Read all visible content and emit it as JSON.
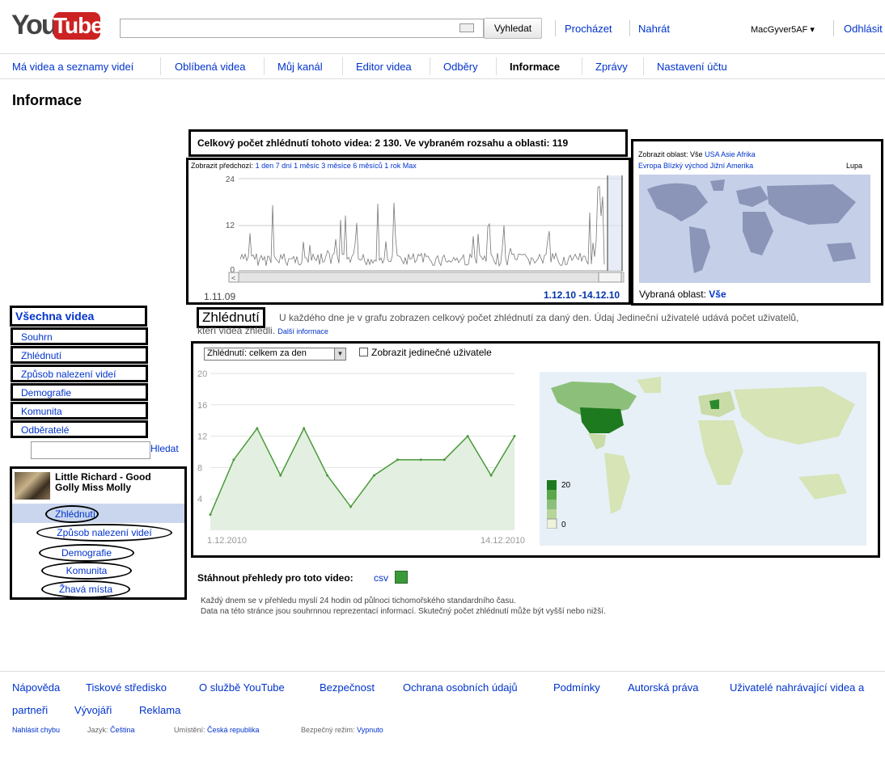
{
  "header": {
    "logo_you": "You",
    "logo_tube": "Tube",
    "search_placeholder": "",
    "search_button": "Vyhledat",
    "browse": "Procházet",
    "upload": "Nahrát",
    "user": "MacGyver5AF ▾",
    "logout": "Odhlásit"
  },
  "tabs": [
    "Má videa a seznamy videí",
    "Oblíbená videa",
    "Můj kanál",
    "Editor videa",
    "Odběry",
    "Informace",
    "Zprávy",
    "Nastavení účtu"
  ],
  "active_tab": "Informace",
  "page_title": "Informace",
  "summary": {
    "text": "Celkový počet zhlédnutí tohoto videa:  2 130.  Ve vybraném rozsahu a oblasti:  119"
  },
  "timeline": {
    "prev_label": "Zobrazit předchozí:",
    "ranges": [
      "1 den",
      "7 dní",
      "1 měsíc",
      "3 měsíce",
      "6 měsíců",
      "1 rok",
      "Max"
    ],
    "y_ticks": [
      "24",
      "12",
      "0"
    ],
    "start": "1.11.09",
    "selected": "1.12.10 -14.12.10"
  },
  "map_panel": {
    "show_region": "Zobrazit oblast:",
    "regions_row1": [
      "Vše",
      "USA",
      "Asie",
      "Afrika"
    ],
    "regions_row2": [
      "Evropa",
      "Blízký východ",
      "Jižní Amerika"
    ],
    "zoom": "Lupa",
    "selected_label": "Vybraná oblast:",
    "selected_value": "Vše"
  },
  "left_nav": {
    "all": "Všechna videa",
    "items": [
      "Souhrn",
      "Zhlédnutí",
      "Způsob nalezení videí",
      "Demografie",
      "Komunita",
      "Odběratelé"
    ],
    "search_button": "Hledat"
  },
  "video": {
    "title": "Little Richard - Good Golly Miss Molly",
    "items": [
      "Zhlédnutí",
      "Způsob nalezení videí",
      "Demografie",
      "Komunita",
      "Žhavá místa"
    ]
  },
  "views_section": {
    "title": "Zhlédnutí",
    "desc": "U každého dne je v grafu zobrazen celkový počet zhlédnutí za daný den. Údaj Jedineční uživatelé udává počet uživatelů,",
    "desc2": "kteří videa zhlédli.",
    "more": "Další informace",
    "select": "Zhlédnutí: celkem za den",
    "checkbox": "Zobrazit jedinečné uživatele",
    "legend_max": "20",
    "legend_min": "0"
  },
  "chart_data": [
    {
      "type": "line",
      "title": "",
      "x": [
        "1.12.2010",
        "2.12.2010",
        "3.12.2010",
        "4.12.2010",
        "5.12.2010",
        "6.12.2010",
        "7.12.2010",
        "8.12.2010",
        "9.12.2010",
        "10.12.2010",
        "11.12.2010",
        "12.12.2010",
        "13.12.2010",
        "14.12.2010"
      ],
      "x_tick_labels": [
        "1.12.2010",
        "14.12.2010"
      ],
      "values": [
        2,
        9,
        13,
        7,
        13,
        7,
        3,
        7,
        9,
        9,
        9,
        12,
        7,
        12
      ],
      "y_ticks": [
        "20",
        "16",
        "12",
        "8",
        "4"
      ],
      "ylim": [
        0,
        20
      ],
      "color": "#4a9a3a",
      "fill": "#e3efe0",
      "grid": true
    }
  ],
  "download": {
    "label": "Stáhnout přehledy pro toto video:",
    "csv": "csv"
  },
  "notes": [
    "Každý dnem se v přehledu myslí 24 hodin od půlnoci tichomořského standardního času.",
    "Data na této stránce jsou souhrnnou reprezentací informací. Skutečný počet zhlédnutí může být vyšší nebo nižší."
  ],
  "footer": {
    "links": [
      "Nápověda",
      "Tiskové středisko",
      "O službě YouTube",
      "Bezpečnost",
      "Ochrana osobních údajů",
      "Podmínky",
      "Autorská práva",
      "Uživatelé nahrávající videa a"
    ],
    "links2": [
      "partneři",
      "Vývojáři",
      "Reklama"
    ],
    "report": "Nahlásit chybu",
    "lang_label": "Jazyk:",
    "lang": "Čeština",
    "loc_label": "Umístění:",
    "loc": "Česká republika",
    "safe_label": "Bezpečný režim:",
    "safe": "Vypnuto"
  }
}
